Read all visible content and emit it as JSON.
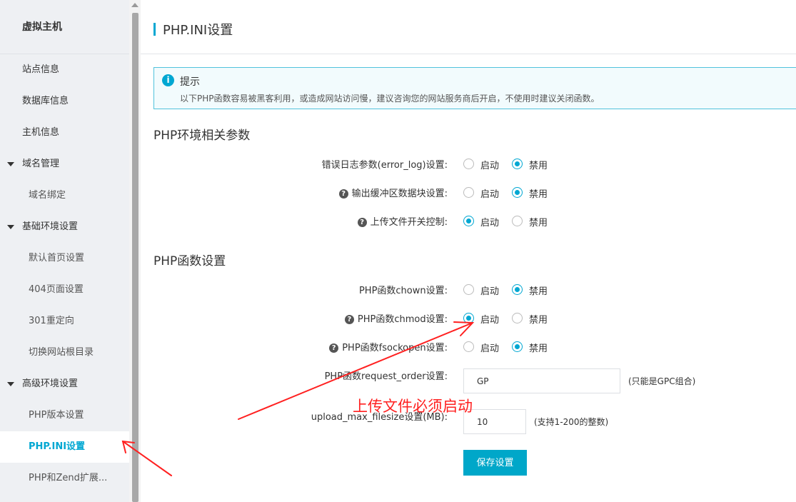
{
  "sidebar": {
    "title": "虚拟主机",
    "items": [
      {
        "label": "站点信息",
        "kind": "top"
      },
      {
        "label": "数据库信息",
        "kind": "top"
      },
      {
        "label": "主机信息",
        "kind": "top"
      },
      {
        "label": "域名管理",
        "kind": "group"
      },
      {
        "label": "域名绑定",
        "kind": "sub"
      },
      {
        "label": "基础环境设置",
        "kind": "group"
      },
      {
        "label": "默认首页设置",
        "kind": "sub"
      },
      {
        "label": "404页面设置",
        "kind": "sub"
      },
      {
        "label": "301重定向",
        "kind": "sub"
      },
      {
        "label": "切换网站根目录",
        "kind": "sub"
      },
      {
        "label": "高级环境设置",
        "kind": "group"
      },
      {
        "label": "PHP版本设置",
        "kind": "sub"
      },
      {
        "label": "PHP.INI设置",
        "kind": "sub",
        "active": true
      },
      {
        "label": "PHP和Zend扩展...",
        "kind": "sub"
      }
    ]
  },
  "page": {
    "title": "PHP.INI设置"
  },
  "tip": {
    "icon": "info-icon",
    "title": "提示",
    "text": "以下PHP函数容易被黑客利用，或造成网站访问慢，建议咨询您的网站服务商后开启，不使用时建议关闭函数。"
  },
  "sections": {
    "env_title": "PHP环境相关参数",
    "func_title": "PHP函数设置"
  },
  "options": {
    "enable": "启动",
    "disable": "禁用"
  },
  "env_rows": [
    {
      "label": "错误日志参数(error_log)设置:",
      "help": false,
      "selected": "disable"
    },
    {
      "label": "输出缓冲区数据块设置:",
      "help": true,
      "selected": "disable"
    },
    {
      "label": "上传文件开关控制:",
      "help": true,
      "selected": "enable"
    }
  ],
  "func_rows": [
    {
      "label": "PHP函数chown设置:",
      "help": false,
      "selected": "disable"
    },
    {
      "label": "PHP函数chmod设置:",
      "help": true,
      "selected": "enable"
    },
    {
      "label": "PHP函数fsockopen设置:",
      "help": true,
      "selected": "disable"
    }
  ],
  "request_order": {
    "label": "PHP函数request_order设置:",
    "value": "GP",
    "hint": "(只能是GPC组合)"
  },
  "upload_max": {
    "label": "upload_max_filesize设置(MB):",
    "value": "10",
    "hint": "(支持1-200的整数)"
  },
  "save_label": "保存设置",
  "annotation": "上传文件必须启动",
  "colors": {
    "accent": "#00a7d2",
    "annotation": "#ff2020"
  }
}
